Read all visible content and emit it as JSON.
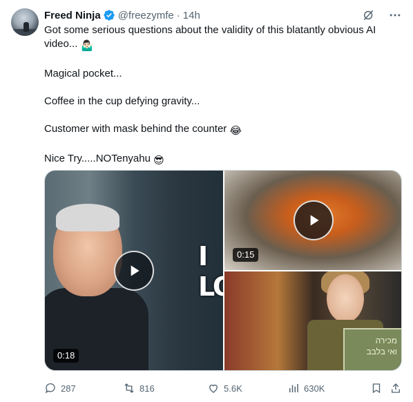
{
  "tweet": {
    "author_name": "Freed Ninja",
    "handle": "@freezymfe",
    "separator": "·",
    "time": "14h",
    "lines": [
      "Got some serious questions about the validity of this blatantly obvious AI video...",
      "Magical pocket...",
      "Coffee in the cup defying gravity...",
      "Customer with mask behind the counter",
      "Nice Try.....NOTenyahu"
    ],
    "emojis": [
      "🤷🏻‍♂️",
      "😂",
      "😎"
    ]
  },
  "icons": {
    "verified": "verified-badge-icon",
    "grok": "grok-icon",
    "more": "more-icon",
    "play": "play-icon"
  },
  "media": {
    "videos": [
      {
        "duration": "0:18",
        "overlay_text": "I LO"
      },
      {
        "duration": "0:15"
      }
    ],
    "sign_text": [
      "מכירה",
      "ואי בלבב"
    ]
  },
  "actions": {
    "replies": "287",
    "reposts": "816",
    "likes": "5.6K",
    "views": "630K"
  },
  "colors": {
    "text": "#0f1419",
    "secondary": "#536471",
    "verified": "#1d9bf0",
    "border": "#cfd9de"
  }
}
